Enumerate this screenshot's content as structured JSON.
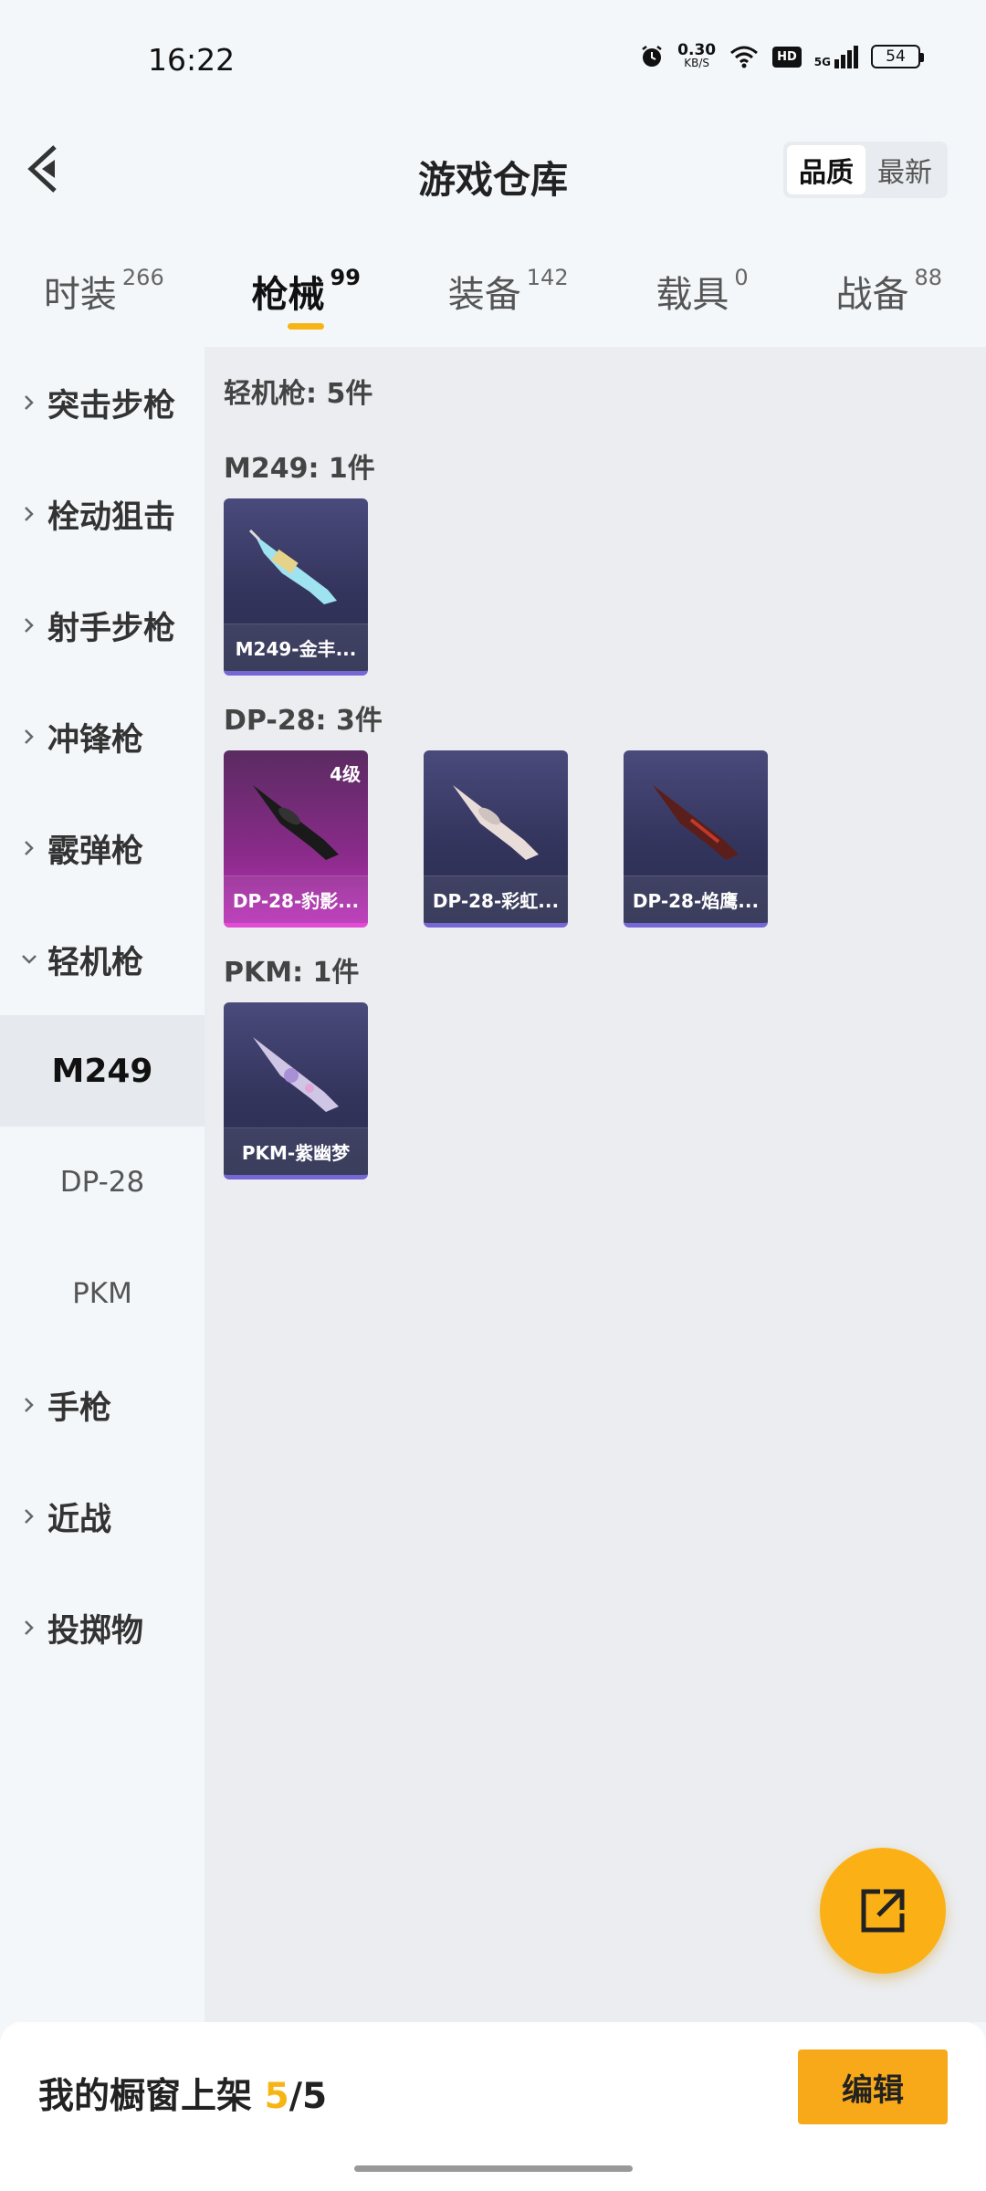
{
  "status": {
    "time": "16:22",
    "net_speed_value": "0.30",
    "net_speed_unit": "KB/S",
    "hd": "HD",
    "network": "5G",
    "battery": "54"
  },
  "header": {
    "title": "游戏仓库",
    "sort_options": [
      "品质",
      "最新"
    ]
  },
  "tabs": [
    {
      "label": "时装",
      "count": "266"
    },
    {
      "label": "枪械",
      "count": "99"
    },
    {
      "label": "装备",
      "count": "142"
    },
    {
      "label": "载具",
      "count": "0"
    },
    {
      "label": "战备",
      "count": "88"
    }
  ],
  "sidebar": {
    "items": [
      {
        "label": "突击步枪"
      },
      {
        "label": "栓动狙击"
      },
      {
        "label": "射手步枪"
      },
      {
        "label": "冲锋枪"
      },
      {
        "label": "霰弹枪"
      },
      {
        "label": "轻机枪"
      }
    ],
    "sub_items": [
      "M249",
      "DP-28",
      "PKM"
    ],
    "items_after": [
      {
        "label": "手枪"
      },
      {
        "label": "近战"
      },
      {
        "label": "投掷物"
      }
    ]
  },
  "content": {
    "total": "轻机枪: 5件",
    "groups": [
      {
        "title": "M249: 1件",
        "items": [
          {
            "name": "M249-金丰...",
            "level": ""
          }
        ]
      },
      {
        "title": "DP-28: 3件",
        "items": [
          {
            "name": "DP-28-豹影...",
            "level": "4级"
          },
          {
            "name": "DP-28-彩虹...",
            "level": ""
          },
          {
            "name": "DP-28-焰鹰...",
            "level": ""
          }
        ]
      },
      {
        "title": "PKM: 1件",
        "items": [
          {
            "name": "PKM-紫幽梦",
            "level": ""
          }
        ]
      }
    ]
  },
  "bottom": {
    "showcase_prefix": "我的橱窗上架 ",
    "showcase_count": "5",
    "showcase_total": "/5",
    "edit_label": "编辑"
  },
  "colors": {
    "accent": "#f6b514",
    "card_purple": "#33345c",
    "card_pink": "#b832b6"
  }
}
